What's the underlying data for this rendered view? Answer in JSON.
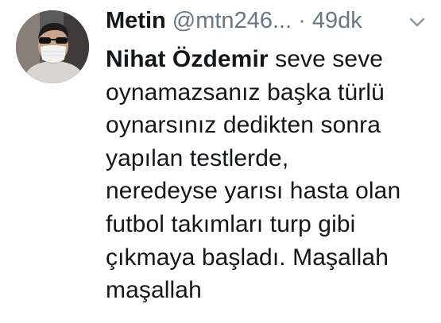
{
  "tweet": {
    "author": {
      "display_name": "Metin",
      "handle": "@mtn246...",
      "avatar_icon": "user-avatar-photo"
    },
    "separator": "·",
    "timestamp": "49dk",
    "menu_icon": "chevron-down-icon",
    "body": {
      "mention": "Nihat Özdemir",
      "lines": [
        " seve seve",
        "oynamazsanız başka türlü",
        "oynarsınız dedikten sonra",
        "yapılan testlerde,",
        "neredeyse yarısı hasta olan",
        "futbol takımları turp gibi",
        "çıkmaya başladı. Maşallah",
        "maşallah"
      ]
    }
  },
  "colors": {
    "text_primary": "#14171a",
    "text_secondary": "#657786",
    "background": "#ffffff"
  }
}
